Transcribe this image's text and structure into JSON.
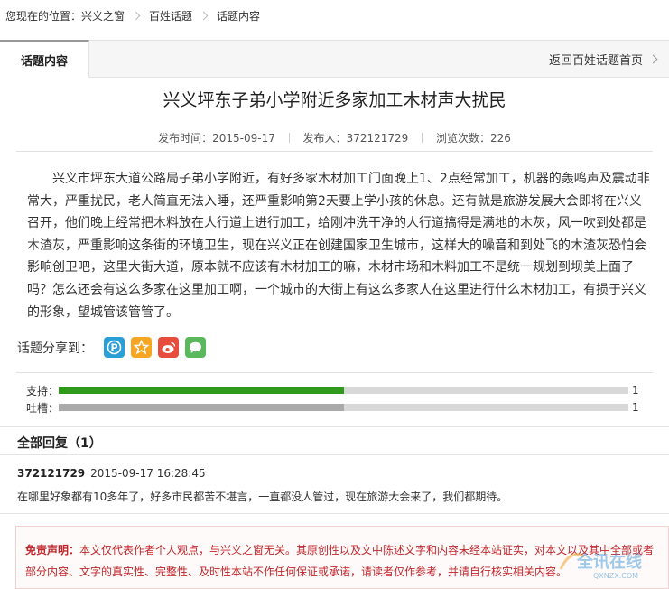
{
  "breadcrumb": {
    "prefix": "您现在的位置：",
    "items": [
      "兴义之窗",
      "百姓话题",
      "话题内容"
    ]
  },
  "tabs": {
    "active": "话题内容",
    "back_link": "返回百姓话题首页"
  },
  "article": {
    "title": "兴义坪东子弟小学附近多家加工木材声大扰民",
    "publish_label": "发布时间：",
    "publish_date": "2015-09-17",
    "author_label": "发布人：",
    "author": "372121729",
    "views_label": "浏览次数：",
    "views": "226",
    "body": "兴义市坪东大道公路局子弟小学附近，有好多家木材加工门面晚上1、2点经常加工，机器的轰鸣声及震动非常大，严重扰民，老人简直无法入睡，还严重影响第2天要上学小孩的休息。还有就是旅游发展大会即将在兴义召开，他们晚上经常把木料放在人行道上进行加工，给刚冲洗干净的人行道搞得是满地的木灰，风一吹到处都是木渣灰，严重影响这条街的环境卫生，现在兴义正在创建国家卫生城市，这样大的噪音和到处飞的木渣灰恐怕会影响创卫吧，这里大街大道，原本就不应该有木材加工的嘛，木材市场和木料加工不是统一规划到坝美上面了吗？怎么还会有这么多家在这里加工啊，一个城市的大街上有这么多家人在这里进行什么木材加工，有损于兴义的形象，望城管该管管了。"
  },
  "share": {
    "label": "话题分享到：",
    "icons": [
      "pinterest-icon",
      "star-icon",
      "weibo-icon",
      "wechat-icon"
    ],
    "colors": [
      "#2a9fd6",
      "#f6a623",
      "#e74c3c",
      "#5cb85c"
    ]
  },
  "votes": {
    "support_label": "支持：",
    "support_count": "1",
    "support_fraction": 0.5,
    "support_color": "#2f9a1c",
    "complain_label": "吐槽：",
    "complain_count": "1",
    "complain_fraction": 0.5,
    "complain_color": "#aaaaaa"
  },
  "replies": {
    "header": "全部回复（1）",
    "items": [
      {
        "user": "372121729",
        "time": "2015-09-17 16:28:45",
        "text": "在哪里好象都有10多年了，好多市民都苦不堪言，一直都没人管过，现在旅游大会来了，我们都期待。"
      }
    ]
  },
  "disclaimer": {
    "label": "免责声明：",
    "text": "本文仅代表作者个人观点，与兴义之窗无关。其原创性以及文中陈述文字和内容未经本站证实，对本文以及其中全部或者部分内容、文字的真实性、完整性、及时性本站不作任何保证或承诺，请读者仅作参考，并请自行核实相关内容。"
  },
  "watermark": {
    "text": "全讯在线",
    "subtext": "QXNZX.COM"
  }
}
